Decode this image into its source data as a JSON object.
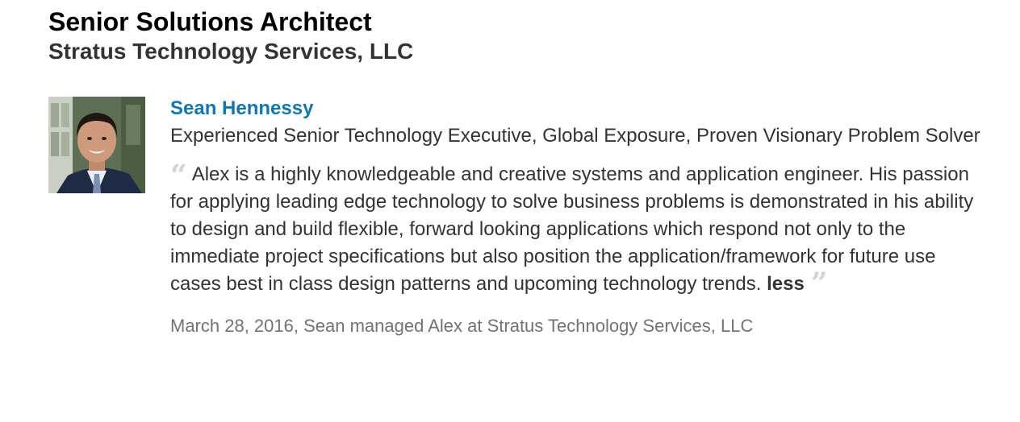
{
  "position": {
    "title": "Senior Solutions Architect",
    "company": "Stratus Technology Services, LLC"
  },
  "recommendation": {
    "recommender_name": "Sean Hennessy",
    "recommender_headline": "Experienced Senior Technology Executive, Global Exposure, Proven Visionary Problem Solver",
    "open_quote": "“",
    "text": "Alex is a highly knowledgeable and creative systems and application engineer. His passion for applying leading edge technology to solve business problems is demonstrated in his ability to design and build flexible, forward looking applications which respond not only to the immediate project specifications but also position the application/framework for future use cases best in class design patterns and upcoming technology trends.",
    "less_label": "less",
    "close_quote": "”",
    "meta": "March 28, 2016, Sean managed Alex at Stratus Technology Services, LLC"
  },
  "colors": {
    "link": "#0e77b5",
    "quote_mark": "#d4d4d4",
    "meta_text": "#737373"
  }
}
